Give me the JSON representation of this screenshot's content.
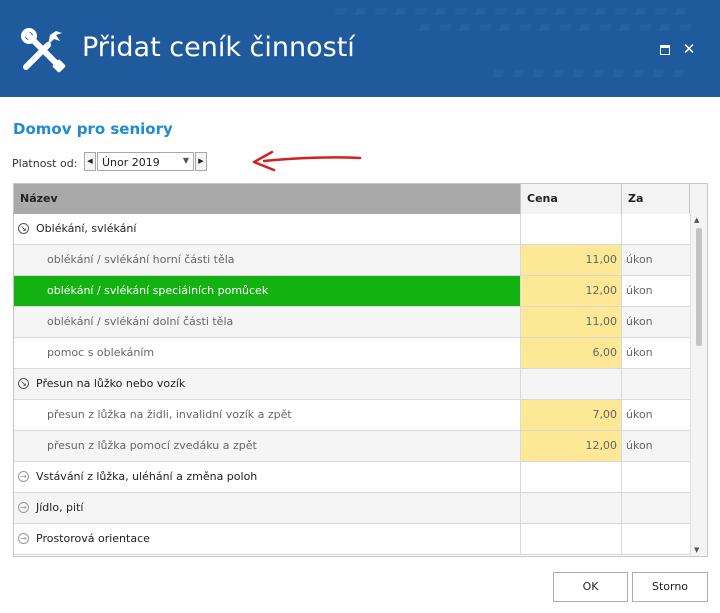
{
  "window": {
    "title": "Přidat ceník činností",
    "icon": "tools-icon",
    "controls": [
      "maximize",
      "close"
    ],
    "close_glyph": "✕"
  },
  "header": {
    "facility": "Domov pro seniory"
  },
  "validity": {
    "label": "Platnost od:",
    "value": "Únor 2019",
    "prev_glyph": "◀",
    "next_glyph": "▶",
    "dropdown_glyph": "▼"
  },
  "grid": {
    "columns": {
      "name": "Název",
      "price": "Cena",
      "unit": "Za"
    },
    "rows": [
      {
        "type": "group",
        "name": "Oblékání, svlékání",
        "expanded": true,
        "price": "",
        "unit": ""
      },
      {
        "type": "item",
        "name": "oblékání / svlékání horní části těla",
        "price": "11,00",
        "unit": "úkon"
      },
      {
        "type": "item",
        "name": "oblékání / svlékání speciálních pomůcek",
        "price": "12,00",
        "unit": "úkon",
        "selected": true
      },
      {
        "type": "item",
        "name": "oblékání / svlékání dolní části těla",
        "price": "11,00",
        "unit": "úkon"
      },
      {
        "type": "item",
        "name": "pomoc s oblekáním",
        "price": "6,00",
        "unit": "úkon"
      },
      {
        "type": "group",
        "name": "Přesun na lůžko nebo vozík",
        "expanded": true,
        "price": "",
        "unit": ""
      },
      {
        "type": "item",
        "name": "přesun z lůžka na židli, invalidní vozík a zpět",
        "price": "7,00",
        "unit": "úkon"
      },
      {
        "type": "item",
        "name": "přesun z lůžka pomocí zvedáku a zpět",
        "price": "12,00",
        "unit": "úkon"
      },
      {
        "type": "group",
        "name": "Vstávání z lůžka, uléhání a změna poloh",
        "expanded": false,
        "price": "",
        "unit": ""
      },
      {
        "type": "group",
        "name": "Jídlo, pití",
        "expanded": false,
        "price": "",
        "unit": ""
      },
      {
        "type": "group",
        "name": "Prostorová orientace",
        "expanded": false,
        "price": "",
        "unit": ""
      }
    ],
    "scroll_up_glyph": "▲",
    "scroll_down_glyph": "▼"
  },
  "footer": {
    "ok_label": "OK",
    "cancel_label": "Storno"
  },
  "colors": {
    "title_bar": "#1f5a9c",
    "heading": "#1e8bd3",
    "selected_row": "#13b112",
    "price_highlight": "#fde895",
    "annotation_arrow": "#d32020"
  }
}
